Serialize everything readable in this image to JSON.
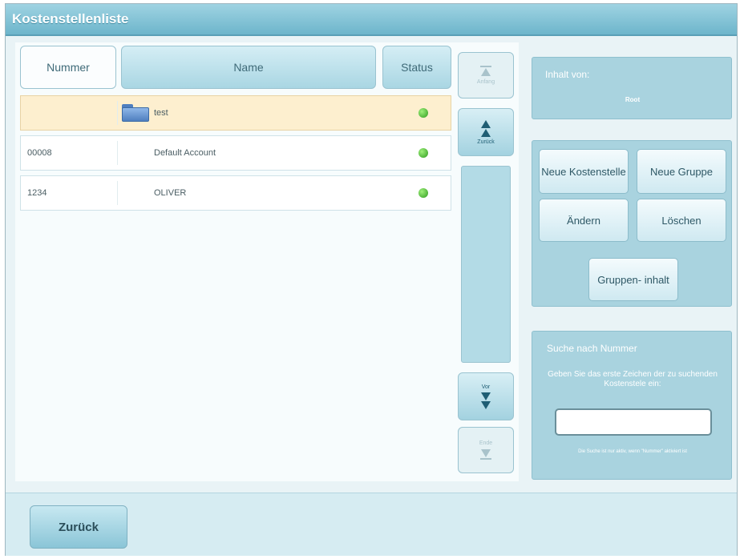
{
  "window": {
    "title": "Kostenstellenliste"
  },
  "table": {
    "columns": [
      "Nummer",
      "Name",
      "Status"
    ],
    "rows": [
      {
        "number": "",
        "name": "test",
        "type": "folder",
        "status": "active",
        "status_color": "#3aa82a"
      },
      {
        "number": "00008",
        "name": "Default Account",
        "type": "account",
        "status": "active",
        "status_color": "#3aa82a"
      },
      {
        "number": "1234",
        "name": "OLIVER",
        "type": "account",
        "status": "active",
        "status_color": "#3aa82a"
      }
    ]
  },
  "scroll": {
    "top_label": "Anfang",
    "up_label": "Zurück",
    "down_label": "Vor",
    "bottom_label": "Ende"
  },
  "info": {
    "heading": "Inhalt von:",
    "value": "Root"
  },
  "actions": {
    "new_cost_center": "Neue Kostenstelle",
    "new_group": "Neue Gruppe",
    "edit": "Ändern",
    "delete": "Löschen",
    "group_content": "Gruppen- inhalt"
  },
  "search": {
    "title": "Suche nach Nummer",
    "instruction": "Geben Sie das erste Zeichen der zu suchenden Kostenstele ein:",
    "value": "",
    "note": "Die Suche ist nur aktiv, wenn \"Nummer\" aktiviert ist"
  },
  "footer": {
    "back_label": "Zurück"
  },
  "colors": {
    "accent": "#6db5cb",
    "selected_row": "#fdefcf",
    "panel": "#a9d3df"
  }
}
